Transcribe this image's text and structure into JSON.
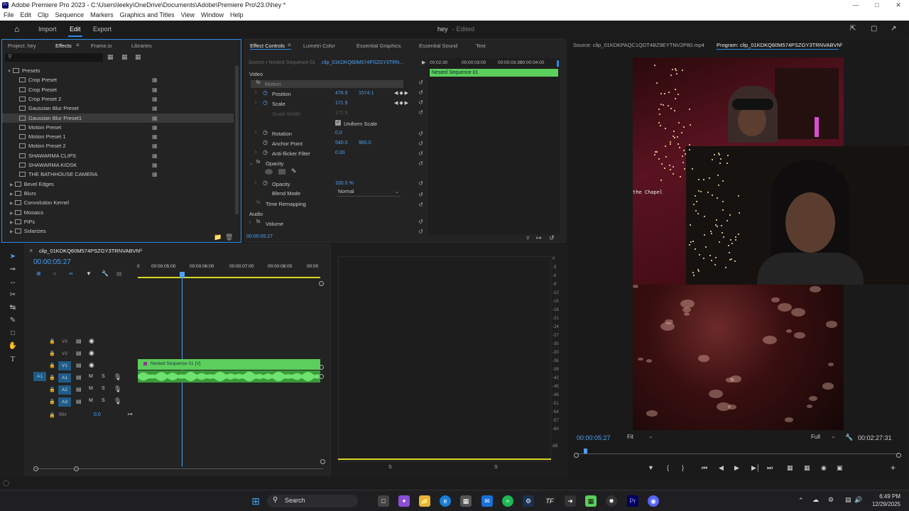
{
  "window": {
    "title": "Adobe Premiere Pro 2023 - C:\\Users\\leeky\\OneDrive\\Documents\\Adobe\\Premiere Pro\\23.0\\hey *",
    "app_icon": "Pr"
  },
  "menu": [
    "File",
    "Edit",
    "Clip",
    "Sequence",
    "Markers",
    "Graphics and Titles",
    "View",
    "Window",
    "Help"
  ],
  "header": {
    "tabs": [
      "Import",
      "Edit",
      "Export"
    ],
    "active_tab": "Edit",
    "project_name": "hey",
    "status": "- Edited"
  },
  "effects_panel": {
    "tabs": [
      "Project: hey",
      "Effects",
      "Frame.io",
      "Libraries"
    ],
    "active_tab": "Effects",
    "presets_label": "Presets",
    "presets": [
      "Crop Preset",
      "Crop Preset",
      "Crop Preset 2",
      "Gaussian Blur Preset",
      "Gaussian Blur Preset1",
      "Motion Preset",
      "Motion Preset 1",
      "Motion Preset 2",
      "SHAWARMA CLIPS",
      "SHAWARMA KIOSK",
      "THE BATHHOUSE CAMERA"
    ],
    "selected_preset": "Gaussian Blur Preset1",
    "folders": [
      "Bevel Edges",
      "Blurs",
      "Convolution Kernel",
      "Mosaics",
      "PiPs",
      "Solarizes"
    ]
  },
  "effect_controls": {
    "tabs": [
      "Effect Controls",
      "Lumetri Color",
      "Essential Graphics",
      "Essential Sound",
      "Text"
    ],
    "active_tab": "Effect Controls",
    "source_label": "Source • Nested Sequence 01",
    "clip_label": "clip_01KDKQ60M574PSZGY3TRN...",
    "section_video": "Video",
    "motion": "Motion",
    "position_label": "Position",
    "position_x": "476.9",
    "position_y": "1574.1",
    "scale_label": "Scale",
    "scale_value": "171.9",
    "scale_width_label": "Scale Width",
    "scale_width_value": "171.9",
    "uniform_scale": "Uniform Scale",
    "rotation_label": "Rotation",
    "rotation_value": "0.0",
    "anchor_label": "Anchor Point",
    "anchor_x": "540.0",
    "anchor_y": "960.0",
    "antiflicker_label": "Anti-flicker Filter",
    "antiflicker_value": "0.00",
    "opacity_section": "Opacity",
    "opacity_label": "Opacity",
    "opacity_value": "100.0 %",
    "blend_label": "Blend Mode",
    "blend_value": "Normal",
    "time_remap": "Time Remapping",
    "section_audio": "Audio",
    "volume": "Volume",
    "timecode": "00:00:05:27",
    "ruler": [
      "00:02:30",
      "00:00:03:00",
      "00:00:03:30",
      "00:00:04:00"
    ],
    "nested_clip": "Nested Sequence 01"
  },
  "source_monitor": {
    "label": "Source: clip_01KDKPAQC1QDT4BZ9EYTNV2P80.mp4"
  },
  "program_monitor": {
    "label": "Program: clip_01KDKQ60M574PSZGY3TRNVABVN",
    "overlay_text": "the Chapel",
    "timecode": "00:00:05:27",
    "fit": "Fit",
    "quality": "Full",
    "duration": "00:02:27:31"
  },
  "timeline": {
    "sequence_name": "clip_01KDKQ60M574PSZGY3TRNVABVN",
    "timecode": "00:00:05:27",
    "ruler": [
      "00:00:05:00",
      "00:00:06:00",
      "00:00:07:00",
      "00:00:08:00",
      "00:00"
    ],
    "tracks_video": [
      "V3",
      "V2",
      "V1"
    ],
    "tracks_audio": [
      "A1",
      "A2",
      "A3"
    ],
    "source_patch_v": "V1",
    "source_patch_a": "A1",
    "mix_label": "Mix",
    "mix_value": "0.0",
    "video_clip": "Nested Sequence 01 [V]"
  },
  "scopes": {
    "db": [
      "0",
      "-6",
      "-12",
      "-18",
      "-24",
      "-30",
      "-36",
      "-42",
      "-48",
      "-54",
      "-60",
      "dB"
    ],
    "db_ext": [
      "-3",
      "-9",
      "-15",
      "-21",
      "-27",
      "-33",
      "-39",
      "-45",
      "-51",
      "-57"
    ],
    "bottom": [
      "S",
      "S"
    ]
  },
  "taskbar": {
    "search": "Search",
    "time": "6:49 PM",
    "date": "12/29/2025"
  },
  "colors": {
    "accent_blue": "#2d8ceb",
    "clip_green": "#5bce5b",
    "timecode_blue": "#4ea1f3"
  }
}
